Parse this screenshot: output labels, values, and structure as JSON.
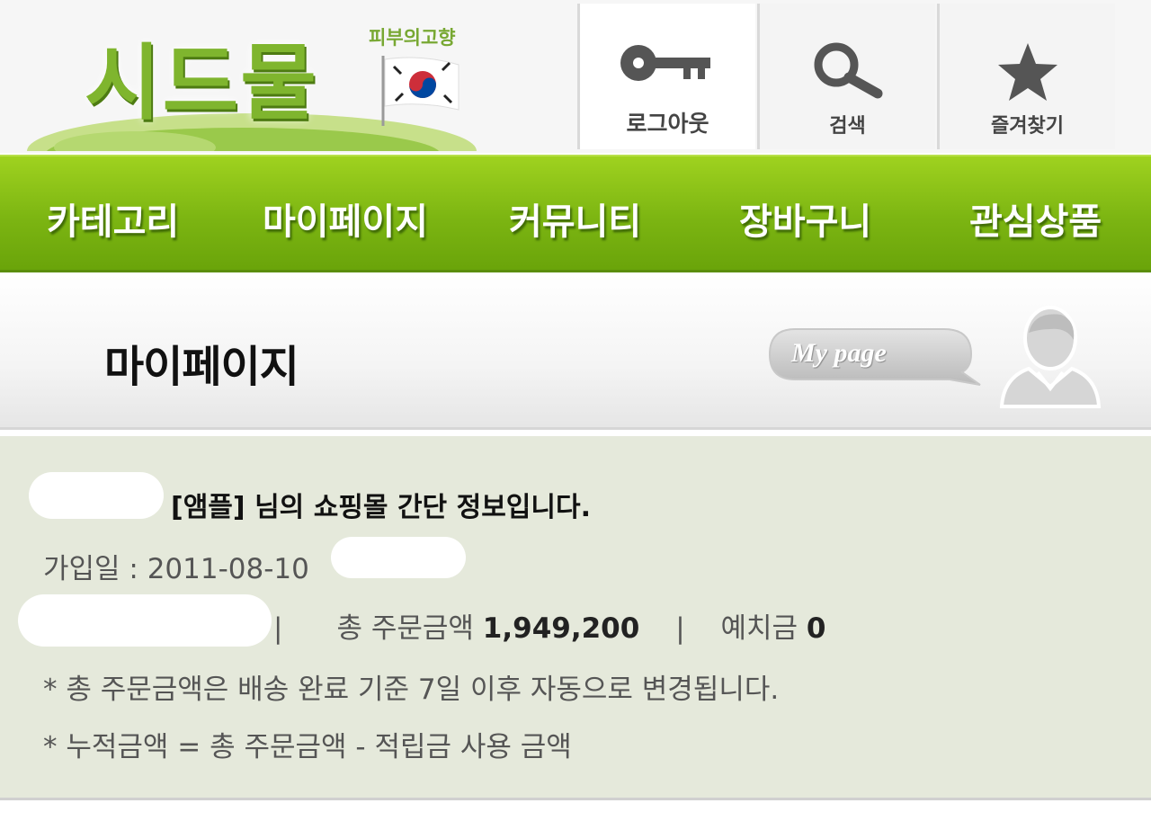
{
  "header": {
    "logo_text": "시드물",
    "logo_subtitle": "피부의고향",
    "buttons": [
      {
        "label": "로그아웃",
        "icon": "key-icon"
      },
      {
        "label": "검색",
        "icon": "search-icon"
      },
      {
        "label": "즐겨찾기",
        "icon": "star-icon"
      }
    ]
  },
  "nav": {
    "items": [
      "카테고리",
      "마이페이지",
      "커뮤니티",
      "장바구니",
      "관심상품"
    ]
  },
  "page": {
    "title": "마이페이지",
    "badge": "My page",
    "icon": "user-icon"
  },
  "info": {
    "greeting": "[앰플] 님의 쇼핑몰 간단 정보입니다.",
    "join_label": "가입일 : 2011-08-10",
    "total_label": "총 주문금액",
    "total_value": "1,949,200",
    "deposit_label": "예치금",
    "deposit_value": "0",
    "separator": "|",
    "note1": "* 총 주문금액은 배송 완료 기준 7일 이후 자동으로 변경됩니다.",
    "note2": "* 누적금액 = 총 주문금액 - 적립금 사용 금액"
  },
  "colors": {
    "nav_green": "#7cb512",
    "logo_green": "#7fb52e",
    "panel_bg": "#e5e9db"
  }
}
